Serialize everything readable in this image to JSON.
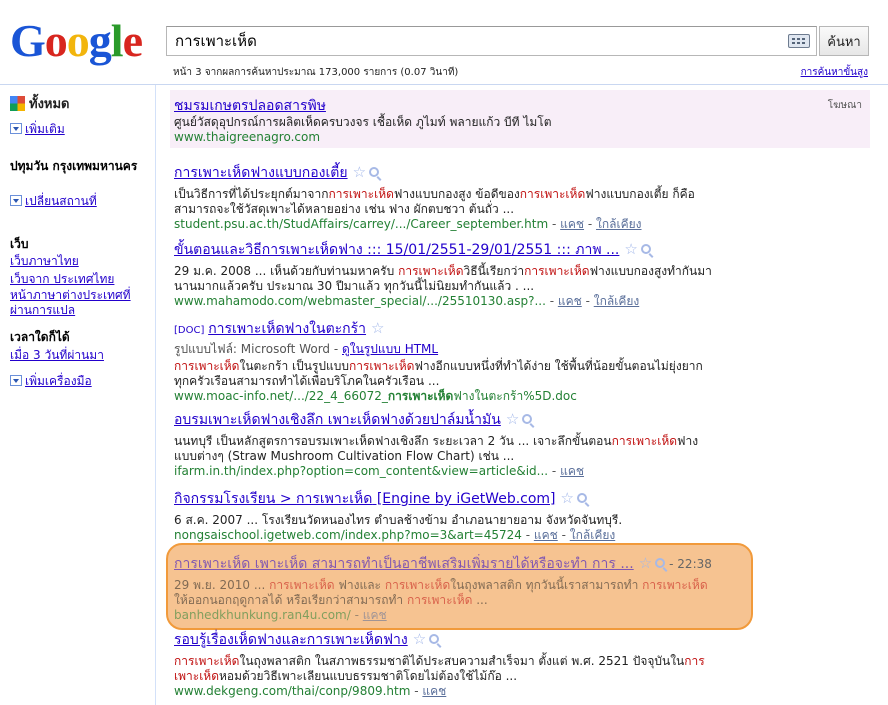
{
  "logo": {
    "text": "Google"
  },
  "search": {
    "query": "การเพาะเห็ด",
    "button_label": "ค้นหา"
  },
  "stats": "หน้า 3 จากผลการค้นหาประมาณ 173,000 รายการ (0.07 วินาที)",
  "advanced_search": "การค้นหาขั้นสูง",
  "sidebar": {
    "everything": "ทั้งหมด",
    "more": "เพิ่มเติม",
    "location_title": "ปทุมวัน กรุงเทพมหานคร",
    "change_location": "เปลี่ยนสถานที่",
    "web_heading": "เว็บ",
    "web_links": [
      "เว็บภาษาไทย",
      "เว็บจาก ประเทศไทย",
      "หน้าภาษาต่างประเทศที่ ผ่านการแปล"
    ],
    "time_heading": "เวลาใดก็ได้",
    "time_link": "เมื่อ 3 วันที่ผ่านมา",
    "more_tools": "เพิ่มเครื่องมือ"
  },
  "ad": {
    "label": "โฆษณา",
    "title": "ชมรมเกษตรปลอดสารพิษ",
    "snippet": "ศูนย์วัสดุอุปกรณ์การผลิตเห็ดครบวงจร เชื้อเห็ด ภูไมท์ พลายแก้ว บีที ไมโต",
    "url": "www.thaigreenagro.com"
  },
  "results": [
    {
      "title": [
        "การเพาะเห็ด",
        "ฟางแบบกองเตี้ย"
      ],
      "snippet1": [
        "เป็นวิธีการที่ได้ประยุกต์มาจาก",
        "การเพาะเห็ด",
        "ฟางแบบกองสูง ข้อดีของ",
        "การเพาะเห็ด",
        "ฟางแบบกองเตี้ย ก็คือ"
      ],
      "snippet2": "สามารถจะใช้วัสดุเพาะได้หลายอย่าง เช่น ฟาง ผักตบชวา ต้นถั่ว ...",
      "url": "student.psu.ac.th/StudAffairs/carrey/.../Career_september.htm",
      "cache": "แคช",
      "similar": "ใกล้เคียง"
    },
    {
      "title": [
        "ขั้นตอนและวิธี",
        "การเพาะเห็ด",
        "ฟาง ::: 15/01/2551-29/01/2551 ::: ภาพ ..."
      ],
      "snippet1": [
        "29 ม.ค. 2008 ... เห็นด้วยกับท่านมหาครับ ",
        "การเพาะเห็ด",
        "วิธีนี้เรียกว่า",
        "การเพาะเห็ด",
        "ฟางแบบกองสูงทำกันมา"
      ],
      "snippet2": "นานมากแล้วครับ ประมาณ 30 ปีมาแล้ว ทุกวันนี้ไม่นิยมทำกันแล้ว . ...",
      "url": "www.mahamodo.com/webmaster_special/.../25510130.asp?...",
      "cache": "แคช",
      "similar": "ใกล้เคียง"
    },
    {
      "filetype": "[DOC]",
      "title": [
        "การเพาะเห็ด",
        "ฟางในตะกร้า"
      ],
      "meta_prefix": "รูปแบบไฟล์: Microsoft Word - ",
      "meta_link": "ดูในรูปแบบ HTML",
      "snippet1": [
        "",
        "การเพาะเห็ด",
        "ในตะกร้า เป็นรูปแบบ",
        "การเพาะเห็ด",
        "ฟางอีกแบบหนึ่งที่ทำได้ง่าย ใช้พื้นที่น้อยขั้นตอนไม่ยุ่งยาก"
      ],
      "snippet2": "ทุกครัวเรือนสามารถทำได้เพื่อบริโภคในครัวเรือน ...",
      "url": [
        "www.moac-info.net/.../22_4_66072_",
        "การเพาะเห็ด",
        "ฟางในตะกร้า%5D.doc"
      ]
    },
    {
      "title": [
        "อบรมเพาะเห็ดฟางเชิงลึก เพาะเห็ดฟางด้วยปาล์มน้ำมัน"
      ],
      "snippet1": [
        "นนทบุรี เป็นหลักสูตรการอบรมเพาะเห็ดฟางเชิงลึก ระยะเวลา 2 วัน ... เจาะลึกขั้นตอน",
        "การเพาะเห็ด",
        "ฟาง"
      ],
      "snippet2": "แบบต่างๆ (Straw Mushroom Cultivation Flow Chart) เช่น ...",
      "url": "ifarm.in.th/index.php?option=com_content&view=article&id...",
      "cache": "แคช"
    },
    {
      "title": [
        "กิจกรรมโรงเรียน > ",
        "การเพาะเห็ด",
        " [Engine by iGetWeb.com]"
      ],
      "snippet1": [
        "6 ส.ค. 2007 ... โรงเรียนวัดหนองไทร ตำบลช้างข้าม อำเภอนายายอาม จังหวัดจันทบุรี."
      ],
      "url": "nongsaischool.igetweb.com/index.php?mo=3&art=45724",
      "cache": "แคช",
      "similar": "ใกล้เคียง"
    },
    {
      "title": [
        "การเพาะเห็ด",
        " เพาะเห็ด สามารถทำเป็นอาชีพเสริมเพิ่มรายได้หรือจะทำ การ ..."
      ],
      "time": "- 22:38",
      "snippet1": [
        "29 พ.ย. 2010 ... ",
        "การเพาะเห็ด",
        " ฟางและ ",
        "การเพาะเห็ด",
        "ในถุงพลาสติก ทุกวันนี้เราสามารถทำ ",
        "การเพาะเห็ด"
      ],
      "snippet2": [
        "ให้ออกนอกฤดูกาลได้ หรือเรียกว่าสามารถทำ ",
        "การเพาะเห็ด",
        " ..."
      ],
      "url": "banhedkhunkung.ran4u.com/",
      "cache": "แคช"
    },
    {
      "title": [
        "รอบรู้เรื่องเห็ดฟางและ",
        "การเพาะเห็ด",
        "ฟาง"
      ],
      "snippet1": [
        "",
        "การเพาะเห็ด",
        "ในถุงพลาสติก ในสภาพธรรมชาติได้ประสบความสำเร็จมา ตั้งแต่ พ.ศ. 2521 ปัจจุบันใน",
        "การ"
      ],
      "snippet2": [
        "",
        "เพาะเห็ด",
        "หอมด้วยวิธีเพาะเลียนแบบธรรมชาติโดยไม่ต้องใช้ไม้ก๊อ ..."
      ],
      "url": "www.dekgeng.com/thai/conp/9809.htm",
      "cache": "แคช"
    }
  ]
}
